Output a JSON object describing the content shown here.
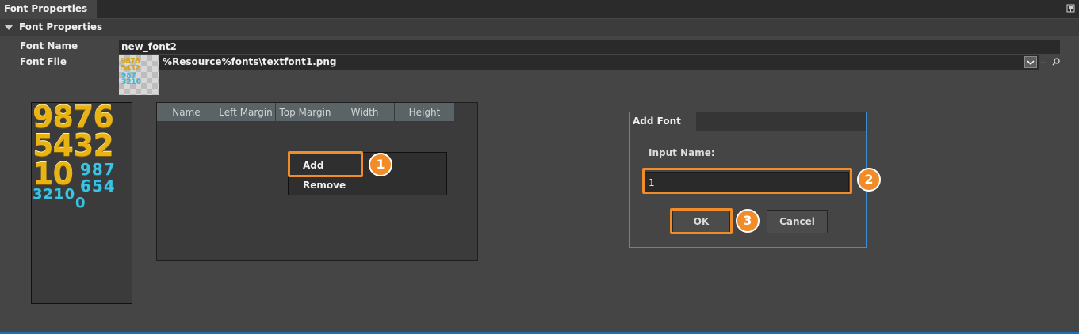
{
  "panel": {
    "tab_title": "Font Properties",
    "section_title": "Font Properties"
  },
  "properties": {
    "font_name_label": "Font Name",
    "font_name_value": "new_font2",
    "font_file_label": "Font File",
    "font_file_value": "%Resource%fonts\\textfont1.png",
    "browse_label": "..."
  },
  "preview": {
    "gold_rows": [
      "9876",
      "5432",
      "10"
    ],
    "cyan_rows": [
      "987",
      "654",
      "3210",
      "0"
    ]
  },
  "grid": {
    "columns": [
      "Name",
      "Left Margin",
      "Top Margin",
      "Width",
      "Height"
    ]
  },
  "context_menu": {
    "items": [
      "Add",
      "Remove"
    ]
  },
  "dialog": {
    "title": "Add Font",
    "input_label": "Input Name:",
    "input_value": "1",
    "ok_label": "OK",
    "cancel_label": "Cancel"
  },
  "steps": [
    "1",
    "2",
    "3"
  ],
  "colors": {
    "highlight": "#f28c28",
    "accent_blue": "#3d8ed6",
    "gold": "#e8b313",
    "cyan": "#3ac3e3"
  }
}
